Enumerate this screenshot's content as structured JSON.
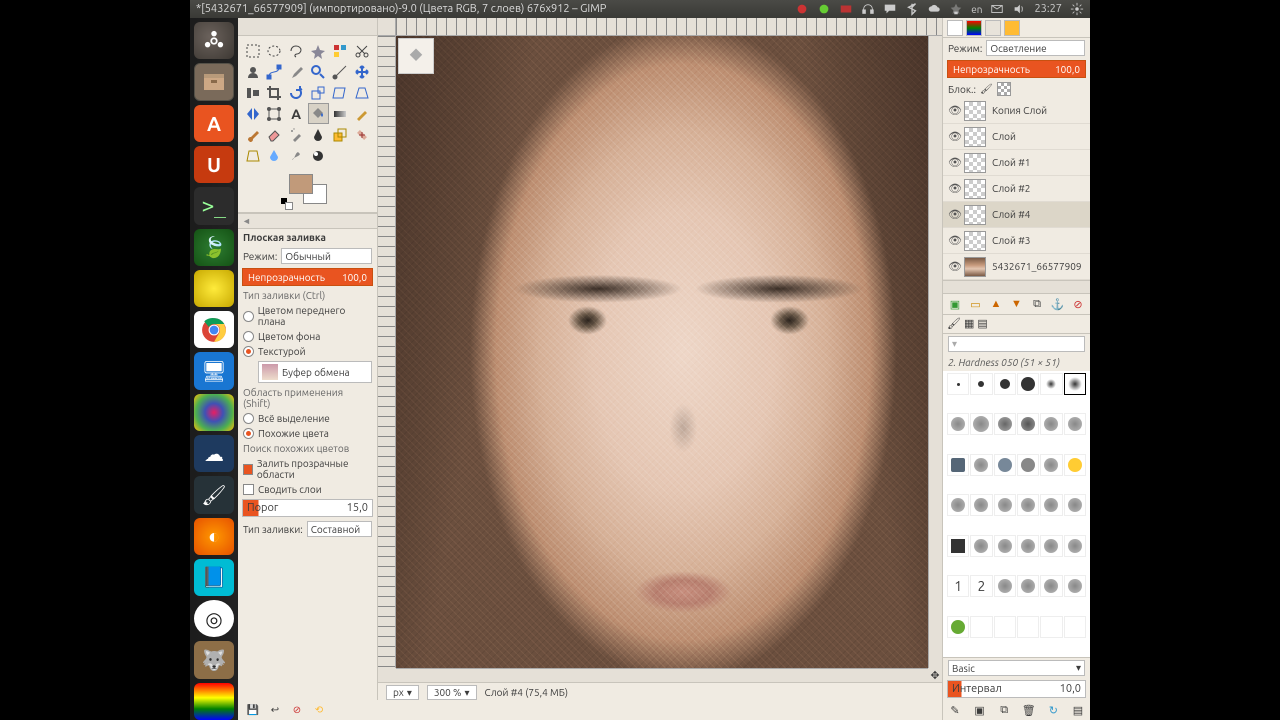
{
  "meta": {
    "window_title": "*[5432671_66577909] (импортировано)-9.0 (Цвета RGB, 7 слоев) 676x912 – GIMP",
    "clock": "23:27"
  },
  "tool_options": {
    "title": "Плоская заливка",
    "mode_label": "Режим:",
    "mode_value": "Обычный",
    "opacity_label": "Непрозрачность",
    "opacity_value": "100,0",
    "fill_section": "Тип заливки (Ctrl)",
    "fill_fg": "Цветом переднего плана",
    "fill_bg": "Цветом фона",
    "fill_pattern": "Текстурой",
    "pattern_name": "Буфер обмена",
    "region_section": "Область применения (Shift)",
    "region_all": "Всё выделение",
    "region_similar": "Похожие цвета",
    "similar_section": "Поиск похожих цветов",
    "fill_transparent": "Залить прозрачные области",
    "merge_layers": "Сводить слои",
    "threshold_label": "Порог",
    "threshold_value": "15,0",
    "criterion_label": "Тип заливки:",
    "criterion_value": "Составной"
  },
  "layers_panel": {
    "mode_label": "Режим:",
    "mode_value": "Осветление",
    "opacity_label": "Непрозрачность",
    "opacity_value": "100,0",
    "lock_label": "Блок.:",
    "items": [
      {
        "name": "Копия Слой"
      },
      {
        "name": "Слой"
      },
      {
        "name": "Слой #1"
      },
      {
        "name": "Слой #2"
      },
      {
        "name": "Слой #4",
        "selected": true
      },
      {
        "name": "Слой #3"
      },
      {
        "name": "5432671_66577909",
        "image": true
      }
    ]
  },
  "brushes": {
    "label": "2. Hardness 050 (51 × 51)",
    "category": "Basic",
    "spacing_label": "Интервал",
    "spacing_value": "10,0"
  },
  "status": {
    "unit": "px",
    "zoom": "300 %",
    "layer_info": "Слой #4 (75,4 МБ)"
  },
  "colors": {
    "accent": "#e95420",
    "fg": "#c19a7a",
    "bg": "#ffffff"
  }
}
